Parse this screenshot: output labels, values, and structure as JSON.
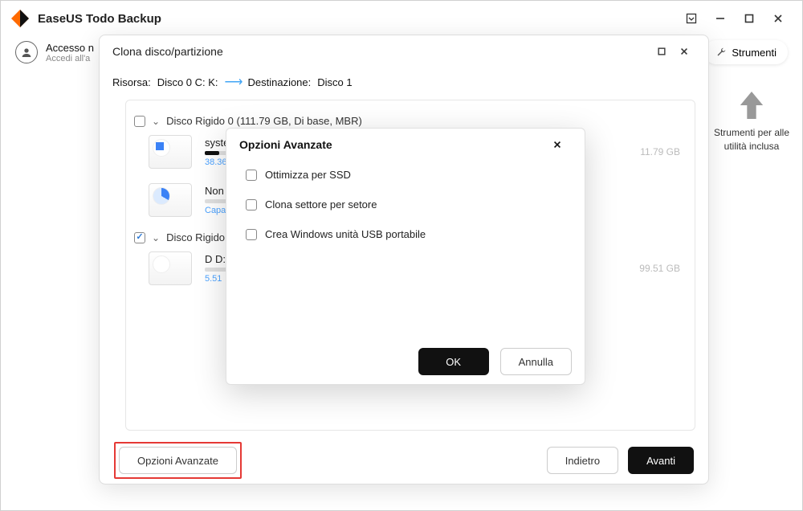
{
  "app": {
    "title": "EaseUS Todo Backup"
  },
  "account": {
    "line1": "Accesso n",
    "line2": "Accedi all'a"
  },
  "toolsButton": "Strumenti",
  "rightHint": "Strumenti per alle utilità inclusa",
  "clone": {
    "title": "Clona disco/partizione",
    "sourceLabel": "Risorsa:",
    "sourceValue": "Disco 0 C: K:",
    "destLabel": "Destinazione:",
    "destValue": "Disco 1",
    "disks": [
      {
        "checked": false,
        "header": "Disco Rigido 0 (111.79 GB, Di base, MBR)",
        "partitions": [
          {
            "name": "syste",
            "size": "38.36",
            "total": "11.79 GB",
            "iconType": "win"
          },
          {
            "name": "Non",
            "size": "Capa",
            "total": "",
            "iconType": "pie"
          }
        ]
      },
      {
        "checked": true,
        "header": "Disco Rigido",
        "partitions": [
          {
            "name": "D D:",
            "size": "5.51",
            "total": "99.51 GB",
            "iconType": "plain"
          }
        ]
      }
    ],
    "advancedButton": "Opzioni Avanzate",
    "backButton": "Indietro",
    "nextButton": "Avanti"
  },
  "advanced": {
    "title": "Opzioni Avanzate",
    "options": [
      "Ottimizza per SSD",
      "Clona settore per setore",
      "Crea Windows unità USB portabile"
    ],
    "ok": "OK",
    "cancel": "Annulla"
  }
}
